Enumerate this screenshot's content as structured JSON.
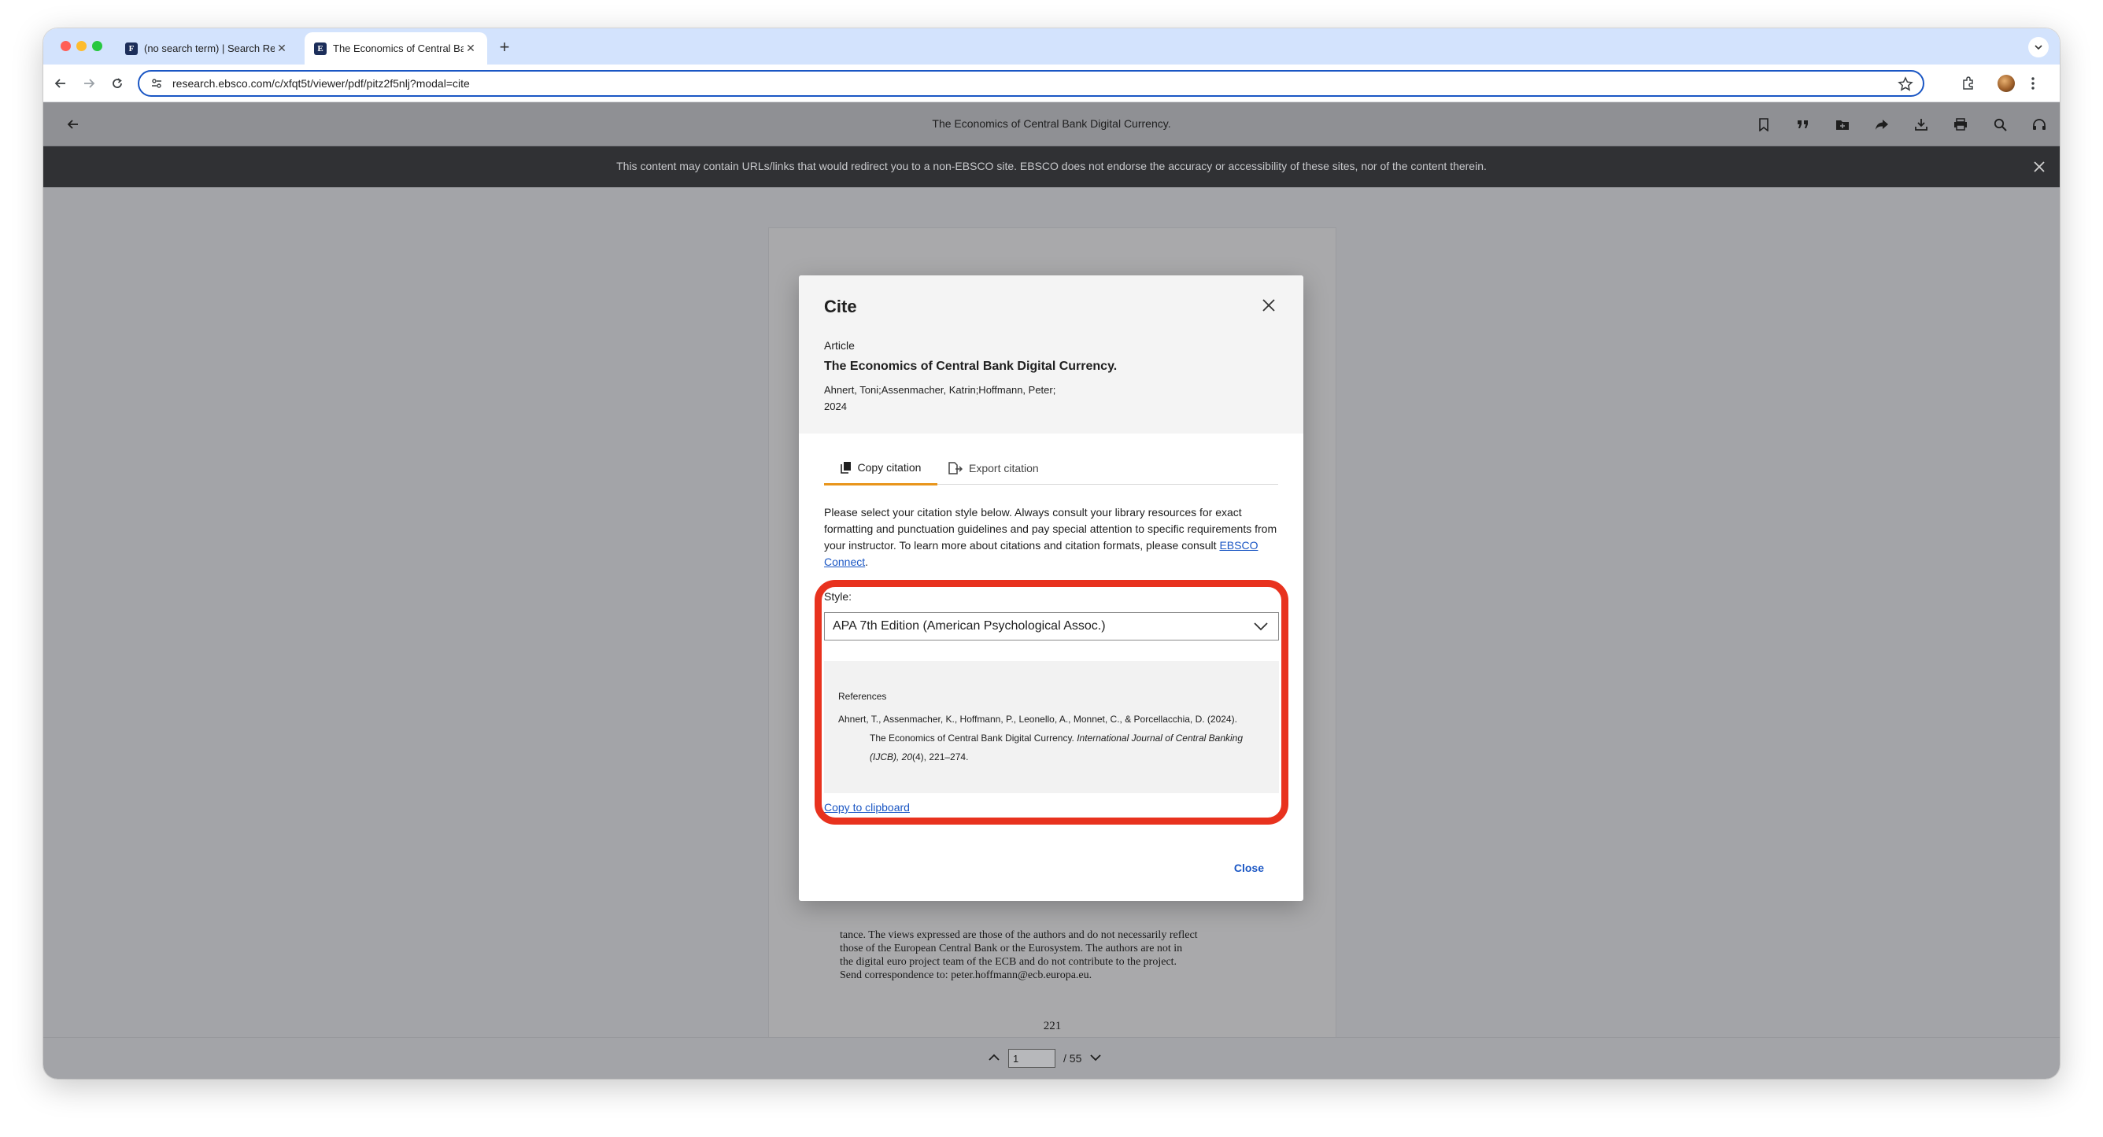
{
  "browser": {
    "tabs": [
      {
        "title": "(no search term) | Search Res",
        "favicon": "F",
        "active": false
      },
      {
        "title": "The Economics of Central Ba",
        "favicon": "E",
        "active": true
      }
    ],
    "url": "research.ebsco.com/c/xfqt5t/viewer/pdf/pitz2f5nlj?modal=cite"
  },
  "viewer": {
    "title": "The Economics of Central Bank Digital Currency.",
    "toolbar_icons": [
      "bookmark-icon",
      "cite-quote-icon",
      "add-folder-icon",
      "share-icon",
      "download-icon",
      "print-icon",
      "search-icon",
      "listen-headphones-icon"
    ]
  },
  "banner": {
    "text": "This content may contain URLs/links that would redirect you to a non-EBSCO site. EBSCO does not endorse the accuracy or accessibility of these sites, nor of the content therein."
  },
  "pdf": {
    "visible_text": [
      "tance. The views expressed are those of the authors and do not necessarily reflect",
      "those of the European Central Bank or the Eurosystem. The authors are not in",
      "the digital euro project team of the ECB and do not contribute to the project.",
      "Send correspondence to: peter.hoffmann@ecb.europa.eu."
    ],
    "page_number": "221"
  },
  "pager": {
    "current_page": "1",
    "total": "/ 55"
  },
  "modal": {
    "title": "Cite",
    "article_type": "Article",
    "article_title": "The Economics of Central Bank Digital Currency.",
    "authors": "Ahnert, Toni;Assenmacher, Katrin;Hoffmann, Peter;",
    "year": "2024",
    "tabs": {
      "copy": "Copy citation",
      "export": "Export citation"
    },
    "instructions": "Please select your citation style below. Always consult your library resources for exact formatting and punctuation guidelines and pay special attention to specific requirements from your instructor. To learn more about citations and citation formats, please consult",
    "instructions_link": "EBSCO Connect",
    "instructions_end": ".",
    "style_label": "Style:",
    "style_value": "APA 7th Edition (American Psychological Assoc.)",
    "references_label": "References",
    "citation": {
      "line1": "Ahnert, T., Assenmacher, K., Hoffmann, P., Leonello, A., Monnet, C., & Porcellacchia, D. (2024).",
      "line2_plain": "The Economics of Central Bank Digital Currency. ",
      "line2_italic": "International Journal of Central Banking",
      "line3_italic": "(IJCB), 20",
      "line3_plain": "(4), 221–274."
    },
    "copy_clipboard": "Copy to clipboard",
    "close": "Close"
  },
  "colors": {
    "accent_tab": "#e8951c",
    "link": "#1a56c4",
    "highlight": "#e8321e"
  }
}
